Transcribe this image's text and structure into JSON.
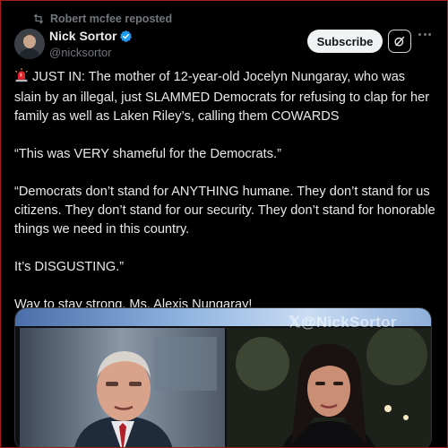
{
  "repost": {
    "text": "Robert mcfee reposted",
    "icon": "repost-icon"
  },
  "author": {
    "display_name": "Nick Sortor",
    "handle": "@nicksortor",
    "verified": true,
    "verified_color": "#1d9bf0"
  },
  "actions": {
    "subscribe_label": "Subscribe",
    "grok_icon": "grok-icon",
    "more_icon": "more-options-icon"
  },
  "tweet": {
    "paragraphs": [
      "JUST IN: The mother of 12-year-old Jocelyn Nungaray, who was slain by an illegal, just SLAMMED Democrats for refusing to clap for her family as well as Laken Riley’s, calling them COWARDS",
      "“This was VERY shameful for the Democrats.”",
      "“Democrats don’t stand for ANYTHING humane. They don’t stand for us citizens. They don’t stand for our security. They don’t stand for honorable things we need in this country.",
      "It’s DISGUSTING.”",
      "Way to stay strong, Ms. Alexis Nungaray!"
    ],
    "leading_emoji": "siren-emoji"
  },
  "media": {
    "watermark": "@NickSortor"
  },
  "colors": {
    "background": "#000000",
    "text": "#e7e9ea",
    "secondary": "#71767b",
    "button_bg": "#eff3f4"
  }
}
